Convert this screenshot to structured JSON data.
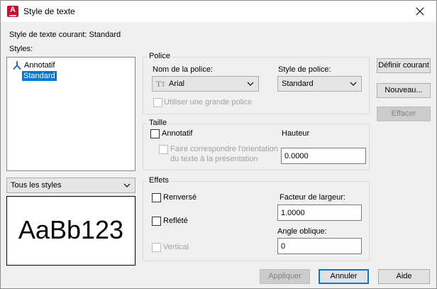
{
  "window": {
    "title": "Style de texte",
    "app_icon_letter": "A"
  },
  "current_style": {
    "label": "Style de texte courant:",
    "value": "Standard"
  },
  "styles": {
    "label": "Styles:",
    "items": [
      {
        "label": "Annotatif",
        "icon": "annotative-icon",
        "selected": false
      },
      {
        "label": "Standard",
        "selected": true
      }
    ],
    "filter": "Tous les styles"
  },
  "preview": {
    "text": "AaBb123"
  },
  "police": {
    "group_label": "Police",
    "font_name_label": "Nom de la police:",
    "font_name_value": "Arial",
    "font_style_label": "Style de police:",
    "font_style_value": "Standard",
    "big_font_label": "Utiliser une grande police"
  },
  "taille": {
    "group_label": "Taille",
    "annotative_label": "Annotatif",
    "match_orientation_line1": "Faire correspondre l'orientation",
    "match_orientation_line2": "du texte à la présentation",
    "height_label": "Hauteur",
    "height_value": "0.0000"
  },
  "effets": {
    "group_label": "Effets",
    "upside_down_label": "Renversé",
    "backwards_label": "Reflété",
    "vertical_label": "Vertical",
    "width_factor_label": "Facteur de largeur:",
    "width_factor_value": "1.0000",
    "oblique_label": "Angle oblique:",
    "oblique_value": "0"
  },
  "buttons": {
    "set_current": "Définir courant",
    "new": "Nouveau...",
    "delete": "Effacer",
    "apply": "Appliquer",
    "cancel": "Annuler",
    "help": "Aide"
  },
  "colors": {
    "selection": "#0078d7",
    "brand": "#c8102e"
  }
}
